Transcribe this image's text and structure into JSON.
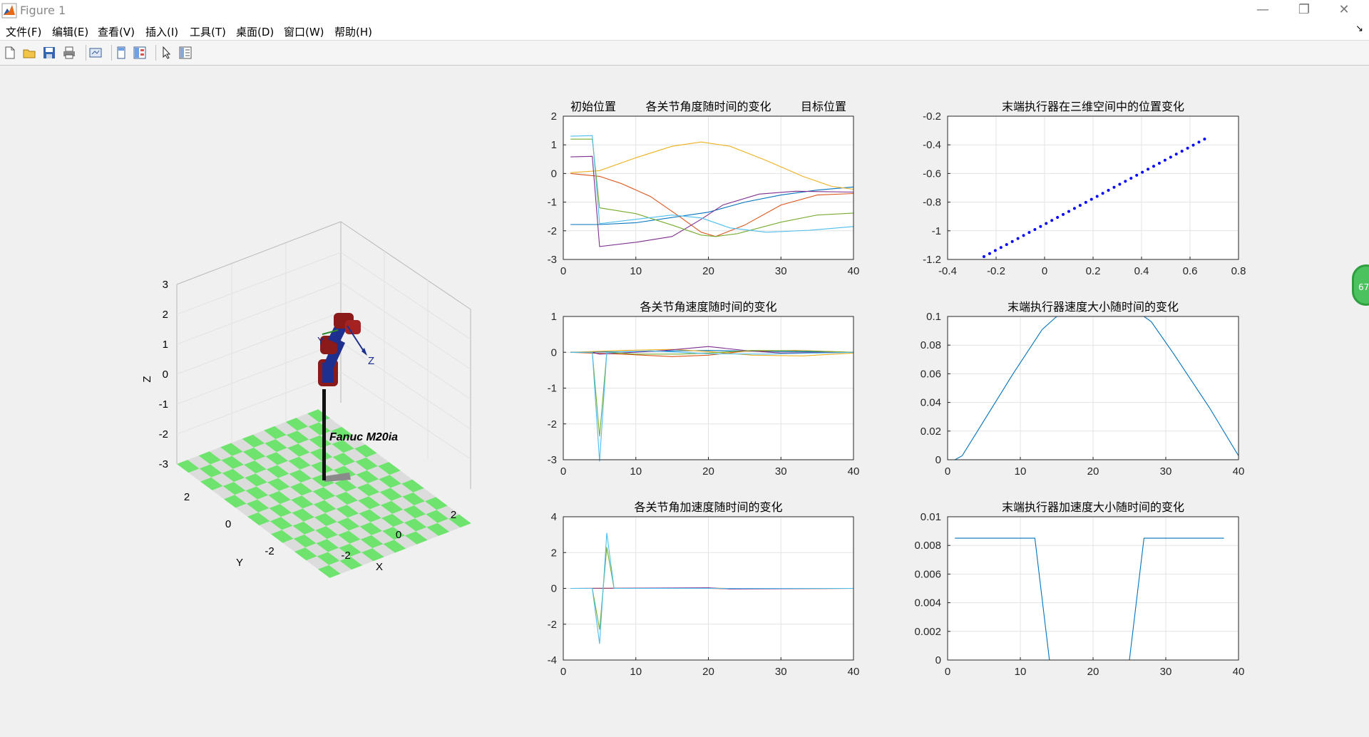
{
  "window": {
    "title": "Figure 1",
    "minimize": "—",
    "restore": "❐",
    "close": "✕"
  },
  "menu": [
    "文件(F)",
    "编辑(E)",
    "查看(V)",
    "插入(I)",
    "工具(T)",
    "桌面(D)",
    "窗口(W)",
    "帮助(H)"
  ],
  "toolbar_icons": [
    "new-figure-icon",
    "open-icon",
    "save-icon",
    "print-icon",
    "link-plot-icon",
    "hide-plot-tools-icon",
    "show-plot-tools-icon",
    "edit-plot-icon",
    "property-inspector-icon"
  ],
  "side_widget": {
    "text": "67"
  },
  "robot_view": {
    "robot_label": "Fanuc M20ia",
    "zlabel": "Z",
    "xlabel": "X",
    "ylabel": "Y",
    "z_ticks": [
      "3",
      "2",
      "1",
      "0",
      "-1",
      "-2",
      "-3"
    ],
    "x_ticks": [
      "-2",
      "0",
      "2"
    ],
    "y_ticks": [
      "2",
      "0",
      "-2"
    ],
    "frame_labels": [
      "Y",
      "Z"
    ]
  },
  "chart_data": [
    {
      "type": "line",
      "title_left": "初始位置",
      "title": "各关节角度随时间的变化",
      "title_right": "目标位置",
      "xlim": [
        0,
        40
      ],
      "ylim": [
        -3,
        2
      ],
      "x_ticks": [
        "0",
        "10",
        "20",
        "30",
        "40"
      ],
      "y_ticks": [
        "2",
        "1",
        "0",
        "-1",
        "-2",
        "-3"
      ],
      "grid": true,
      "series": [
        {
          "color": "#0072bd",
          "points": [
            [
              1,
              -1.78
            ],
            [
              5,
              -1.78
            ],
            [
              10,
              -1.72
            ],
            [
              20,
              -1.35
            ],
            [
              25,
              -1.0
            ],
            [
              30,
              -0.75
            ],
            [
              35,
              -0.58
            ],
            [
              40,
              -0.47
            ]
          ]
        },
        {
          "color": "#d95319",
          "points": [
            [
              1,
              0.0
            ],
            [
              5,
              -0.1
            ],
            [
              8,
              -0.35
            ],
            [
              12,
              -0.8
            ],
            [
              16,
              -1.5
            ],
            [
              19,
              -2.05
            ],
            [
              21,
              -2.2
            ],
            [
              25,
              -1.8
            ],
            [
              30,
              -1.1
            ],
            [
              35,
              -0.75
            ],
            [
              40,
              -0.7
            ]
          ]
        },
        {
          "color": "#edb120",
          "points": [
            [
              1,
              0.03
            ],
            [
              5,
              0.1
            ],
            [
              10,
              0.55
            ],
            [
              15,
              0.95
            ],
            [
              19,
              1.1
            ],
            [
              23,
              0.95
            ],
            [
              28,
              0.45
            ],
            [
              33,
              -0.1
            ],
            [
              37,
              -0.45
            ],
            [
              40,
              -0.55
            ]
          ]
        },
        {
          "color": "#7e2f8e",
          "points": [
            [
              1,
              0.58
            ],
            [
              4,
              0.6
            ],
            [
              5,
              -2.55
            ],
            [
              10,
              -2.4
            ],
            [
              15,
              -2.2
            ],
            [
              19,
              -1.6
            ],
            [
              22,
              -1.1
            ],
            [
              27,
              -0.72
            ],
            [
              32,
              -0.62
            ],
            [
              40,
              -0.65
            ]
          ]
        },
        {
          "color": "#77ac30",
          "points": [
            [
              1,
              1.2
            ],
            [
              4,
              1.2
            ],
            [
              5,
              -1.2
            ],
            [
              10,
              -1.4
            ],
            [
              15,
              -1.8
            ],
            [
              19,
              -2.15
            ],
            [
              21,
              -2.2
            ],
            [
              24,
              -2.1
            ],
            [
              30,
              -1.7
            ],
            [
              35,
              -1.45
            ],
            [
              40,
              -1.38
            ]
          ]
        },
        {
          "color": "#4dbeee",
          "points": [
            [
              1,
              1.3
            ],
            [
              4,
              1.32
            ],
            [
              5,
              -1.75
            ],
            [
              10,
              -1.6
            ],
            [
              15,
              -1.45
            ],
            [
              19,
              -1.55
            ],
            [
              23,
              -1.9
            ],
            [
              28,
              -2.05
            ],
            [
              34,
              -1.98
            ],
            [
              40,
              -1.85
            ]
          ]
        }
      ]
    },
    {
      "type": "scatter",
      "title": "末端执行器在三维空间中的位置变化",
      "xlim": [
        -0.4,
        0.8
      ],
      "ylim": [
        -1.2,
        -0.2
      ],
      "x_ticks": [
        "-0.4",
        "-0.2",
        "0",
        "0.2",
        "0.4",
        "0.6",
        "0.8"
      ],
      "y_ticks": [
        "-0.2",
        "-0.4",
        "-0.6",
        "-0.8",
        "-1",
        "-1.2"
      ],
      "grid": true,
      "color": "#0000ff",
      "x_start": -0.25,
      "y_start": -1.18,
      "x_end": 0.66,
      "y_end": -0.36,
      "n_points": 40
    },
    {
      "type": "line",
      "title": "各关节角速度随时间的变化",
      "xlim": [
        0,
        40
      ],
      "ylim": [
        -3,
        1
      ],
      "x_ticks": [
        "0",
        "10",
        "20",
        "30",
        "40"
      ],
      "y_ticks": [
        "1",
        "0",
        "-1",
        "-2",
        "-3"
      ],
      "grid": true,
      "series": [
        {
          "color": "#0072bd",
          "points": [
            [
              1,
              0
            ],
            [
              10,
              0.02
            ],
            [
              20,
              0.05
            ],
            [
              30,
              0.02
            ],
            [
              40,
              0.0
            ]
          ]
        },
        {
          "color": "#d95319",
          "points": [
            [
              1,
              0
            ],
            [
              8,
              -0.05
            ],
            [
              15,
              -0.12
            ],
            [
              20,
              -0.08
            ],
            [
              25,
              0.03
            ],
            [
              32,
              0.05
            ],
            [
              40,
              0.0
            ]
          ]
        },
        {
          "color": "#edb120",
          "points": [
            [
              1,
              0
            ],
            [
              8,
              0.05
            ],
            [
              15,
              0.08
            ],
            [
              20,
              0.02
            ],
            [
              26,
              -0.08
            ],
            [
              33,
              -0.1
            ],
            [
              40,
              -0.02
            ]
          ]
        },
        {
          "color": "#7e2f8e",
          "points": [
            [
              1,
              0
            ],
            [
              4,
              0
            ],
            [
              5,
              -0.05
            ],
            [
              8,
              -0.02
            ],
            [
              14,
              0.05
            ],
            [
              20,
              0.16
            ],
            [
              25,
              0.05
            ],
            [
              30,
              -0.02
            ],
            [
              40,
              0.0
            ]
          ]
        },
        {
          "color": "#77ac30",
          "points": [
            [
              1,
              0
            ],
            [
              4,
              0
            ],
            [
              5,
              -2.35
            ],
            [
              6,
              0
            ],
            [
              10,
              -0.05
            ],
            [
              16,
              -0.05
            ],
            [
              20,
              -0.02
            ],
            [
              26,
              0.05
            ],
            [
              33,
              0.04
            ],
            [
              40,
              0.0
            ]
          ]
        },
        {
          "color": "#4dbeee",
          "points": [
            [
              1,
              0
            ],
            [
              4,
              0
            ],
            [
              5,
              -3.05
            ],
            [
              6,
              0
            ],
            [
              12,
              0.04
            ],
            [
              20,
              -0.04
            ],
            [
              28,
              -0.05
            ],
            [
              40,
              0.0
            ]
          ]
        }
      ]
    },
    {
      "type": "line",
      "title": "末端执行器速度大小随时间的变化",
      "xlim": [
        0,
        40
      ],
      "ylim": [
        0,
        0.11
      ],
      "x_ticks": [
        "0",
        "10",
        "20",
        "30",
        "40"
      ],
      "y_ticks": [
        "0.1",
        "0.08",
        "0.06",
        "0.04",
        "0.02",
        "0"
      ],
      "grid": true,
      "series": [
        {
          "color": "#0072bd",
          "points": [
            [
              1,
              0
            ],
            [
              2,
              0.003
            ],
            [
              5,
              0.03
            ],
            [
              9,
              0.066
            ],
            [
              13,
              0.1
            ],
            [
              15,
              0.11
            ],
            [
              27,
              0.11
            ],
            [
              28,
              0.106
            ],
            [
              31,
              0.082
            ],
            [
              36,
              0.04
            ],
            [
              40,
              0.003
            ]
          ]
        }
      ]
    },
    {
      "type": "line",
      "title": "各关节角加速度随时间的变化",
      "xlim": [
        0,
        40
      ],
      "ylim": [
        -4,
        4
      ],
      "x_ticks": [
        "0",
        "10",
        "20",
        "30",
        "40"
      ],
      "y_ticks": [
        "4",
        "2",
        "0",
        "-2",
        "-4"
      ],
      "grid": true,
      "series": [
        {
          "color": "#0072bd",
          "points": [
            [
              1,
              0
            ],
            [
              40,
              0
            ]
          ]
        },
        {
          "color": "#d95319",
          "points": [
            [
              1,
              0
            ],
            [
              18,
              0.02
            ],
            [
              22,
              -0.02
            ],
            [
              40,
              0
            ]
          ]
        },
        {
          "color": "#edb120",
          "points": [
            [
              1,
              0
            ],
            [
              20,
              0.02
            ],
            [
              25,
              -0.02
            ],
            [
              40,
              0
            ]
          ]
        },
        {
          "color": "#7e2f8e",
          "points": [
            [
              1,
              0
            ],
            [
              20,
              0.03
            ],
            [
              23,
              -0.03
            ],
            [
              40,
              0
            ]
          ]
        },
        {
          "color": "#77ac30",
          "points": [
            [
              1,
              0
            ],
            [
              4,
              0
            ],
            [
              5,
              -2.3
            ],
            [
              6,
              2.3
            ],
            [
              7,
              0
            ],
            [
              40,
              0
            ]
          ]
        },
        {
          "color": "#4dbeee",
          "points": [
            [
              1,
              0
            ],
            [
              4,
              0
            ],
            [
              5,
              -3.1
            ],
            [
              6,
              3.1
            ],
            [
              7,
              0
            ],
            [
              40,
              0
            ]
          ]
        }
      ]
    },
    {
      "type": "line",
      "title": "末端执行器加速度大小随时间的变化",
      "xlim": [
        0,
        40
      ],
      "ylim": [
        0,
        0.01
      ],
      "x_ticks": [
        "0",
        "10",
        "20",
        "30",
        "40"
      ],
      "y_ticks": [
        "0.01",
        "0.008",
        "0.006",
        "0.004",
        "0.002",
        "0"
      ],
      "grid": true,
      "series": [
        {
          "color": "#0072bd",
          "points": [
            [
              1,
              0.0085
            ],
            [
              12,
              0.0085
            ],
            [
              14,
              0
            ],
            [
              25,
              0
            ],
            [
              27,
              0.0085
            ],
            [
              38,
              0.0085
            ]
          ]
        }
      ]
    }
  ]
}
